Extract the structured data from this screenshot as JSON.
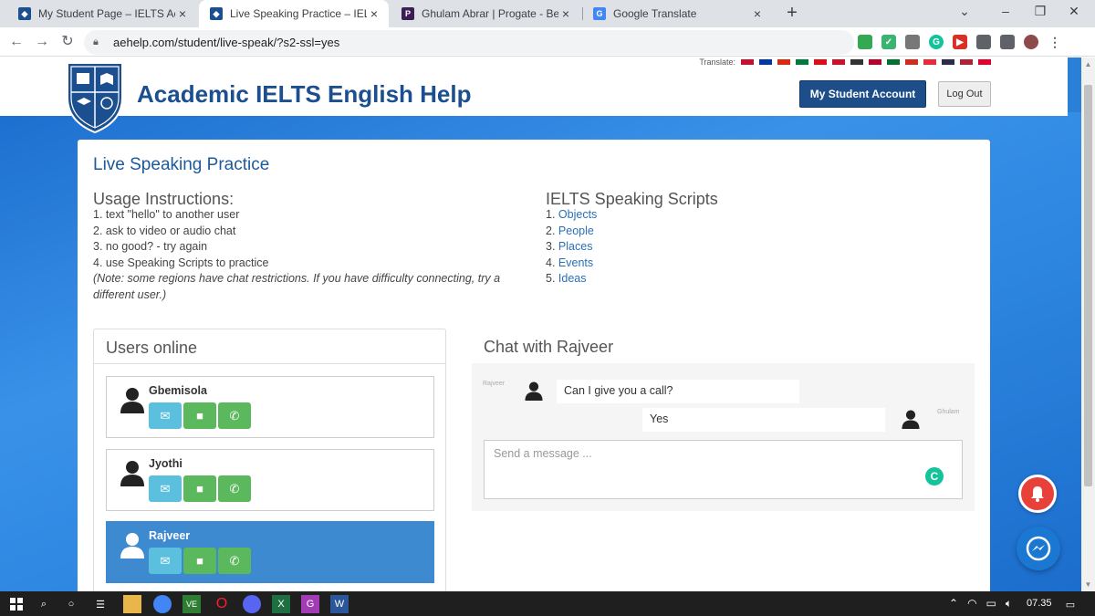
{
  "browser": {
    "tabs": [
      {
        "title": "My Student Page – IELTS Academ",
        "favicon_color": "#1c4f8f",
        "icon": "shield-icon"
      },
      {
        "title": "Live Speaking Practice – IELTS Ac",
        "favicon_color": "#1c4f8f",
        "icon": "shield-icon"
      },
      {
        "title": "Ghulam Abrar | Progate - Belajar",
        "favicon_color": "#3b1e54",
        "icon": "progate-icon"
      },
      {
        "title": "Google Translate",
        "favicon_color": "#4285f4",
        "icon": "translate-icon"
      }
    ],
    "address": "aehelp.com/student/live-speak/?s2-ssl=yes"
  },
  "header": {
    "translate_label": "Translate:",
    "site_title": "Academic IELTS English Help",
    "account_button": "My Student Account",
    "logout_button": "Log Out"
  },
  "main": {
    "page_title": "Live Speaking Practice",
    "instructions": {
      "heading": "Usage Instructions:",
      "items": [
        "1. text \"hello\" to another user",
        "2. ask to video or audio chat",
        "3. no good? - try again",
        "4. use Speaking Scripts to practice"
      ],
      "note": "(Note: some regions have chat restrictions. If you have difficulty connecting, try a different user.)"
    },
    "scripts": {
      "heading": "IELTS Speaking Scripts",
      "items": [
        {
          "num": "1.",
          "label": "Objects"
        },
        {
          "num": "2.",
          "label": "People"
        },
        {
          "num": "3.",
          "label": "Places"
        },
        {
          "num": "4.",
          "label": "Events"
        },
        {
          "num": "5.",
          "label": "Ideas"
        }
      ]
    }
  },
  "users_panel": {
    "heading": "Users online",
    "users": [
      {
        "name": "Gbemisola",
        "selected": false
      },
      {
        "name": "Jyothi",
        "selected": false
      },
      {
        "name": "Rajveer",
        "selected": true
      }
    ]
  },
  "chat": {
    "heading": "Chat with Rajveer",
    "messages": [
      {
        "sender": "Rajveer",
        "text": "Can I give you a call?"
      },
      {
        "sender": "Ghulam",
        "text": "Yes"
      }
    ],
    "input_placeholder": "Send a message ..."
  },
  "taskbar": {
    "clock": "07.35"
  },
  "colors": {
    "brand": "#1c4f8f",
    "accent_blue": "#2a7fd6",
    "selected_user": "#3d8ad0",
    "info_button": "#5bc0de",
    "success_button": "#5cb85c"
  }
}
